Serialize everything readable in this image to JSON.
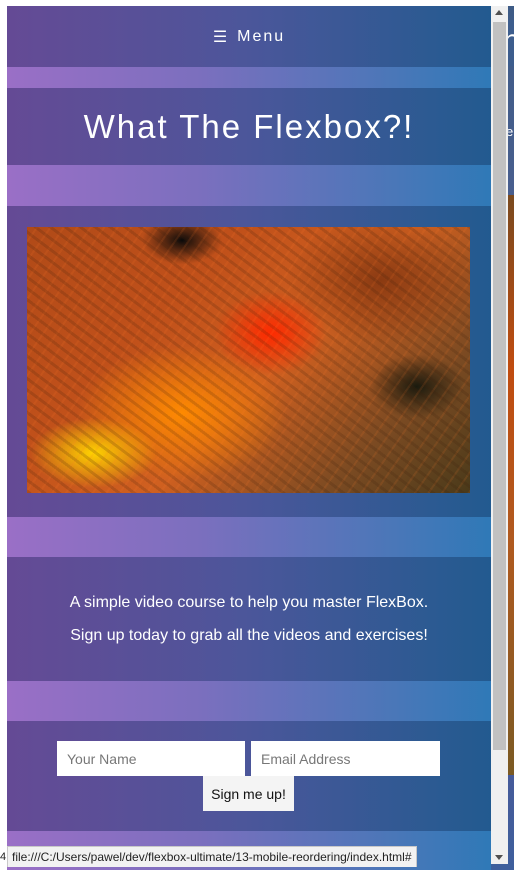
{
  "nav": {
    "menu_icon": "hamburger-icon",
    "menu_label": "Menu"
  },
  "hero": {
    "title": "What The Flexbox?!"
  },
  "media": {
    "image_alt": "course image"
  },
  "info": {
    "line1": "A simple video course to help you master FlexBox.",
    "line2": "Sign up today to grab all the videos and exercises!"
  },
  "signup": {
    "name_placeholder": "Your Name",
    "email_placeholder": "Email Address",
    "button_label": "Sign me up!"
  },
  "status_bar": {
    "url": "file:///C:/Users/pawel/dev/flexbox-ultimate/13-mobile-reordering/index.html#"
  },
  "background_window": {
    "fragment_left": "4",
    "title_fragment": "h",
    "text_fragment": "e"
  }
}
